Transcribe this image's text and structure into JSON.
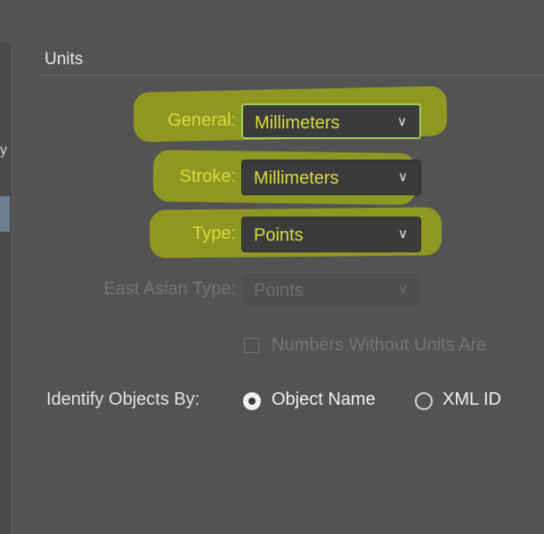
{
  "sidebar": {
    "partial_glyph": "y"
  },
  "units_section": {
    "title": "Units"
  },
  "general": {
    "label": "General:",
    "value": "Millimeters"
  },
  "stroke": {
    "label": "Stroke:",
    "value": "Millimeters"
  },
  "type": {
    "label": "Type:",
    "value": "Points"
  },
  "east_asian_type": {
    "label": "East Asian Type:",
    "value": "Points"
  },
  "numbers_without_units": {
    "label": "Numbers Without Units Are",
    "checked": false
  },
  "identify_objects": {
    "label": "Identify Objects By:",
    "options": [
      {
        "label": "Object Name",
        "selected": true
      },
      {
        "label": "XML ID",
        "selected": false
      }
    ]
  },
  "icons": {
    "dropdown": "chevron-down-icon"
  },
  "colors": {
    "panel_bg": "#535353",
    "highlighter": "#a0aa14",
    "focus_border": "#9fcf5a"
  }
}
